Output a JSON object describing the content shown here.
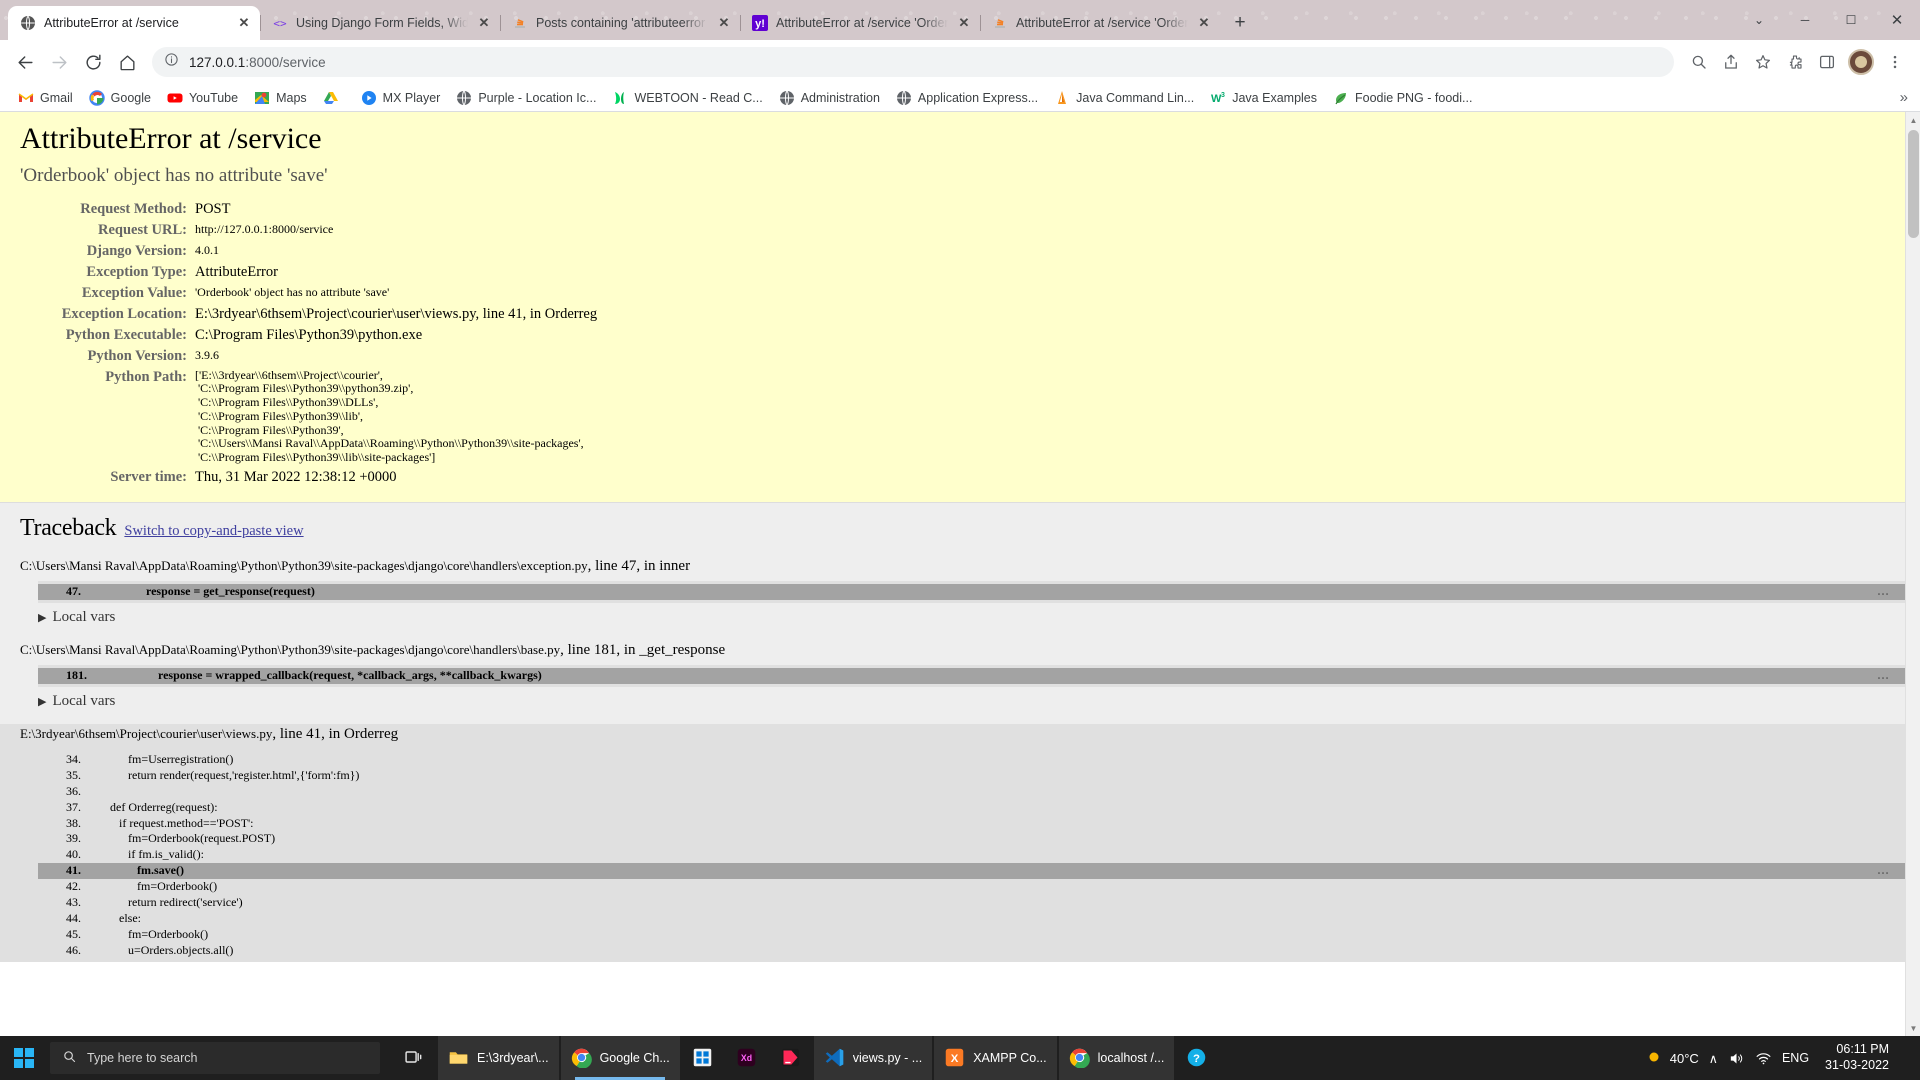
{
  "browser": {
    "tabs": [
      {
        "title": "AttributeError at /service",
        "favicon": "globe-icon",
        "active": true
      },
      {
        "title": "Using Django Form Fields, Widge",
        "favicon": "code-icon",
        "active": false
      },
      {
        "title": "Posts containing 'attributeerror a",
        "favicon": "stackoverflow-icon",
        "active": false
      },
      {
        "title": "AttributeError at /service 'Orderb",
        "favicon": "yahoo-icon",
        "active": false
      },
      {
        "title": "AttributeError at /service 'Orderb",
        "favicon": "stackoverflow-icon",
        "active": false
      }
    ],
    "new_tab_label": "+",
    "window_controls": {
      "minimize": "─",
      "maximize": "☐",
      "close": "✕",
      "restore_down": "⌄"
    },
    "toolbar": {
      "back": "←",
      "forward": "→",
      "reload": "⟳",
      "home": "⌂",
      "url": "127.0.0.1:8000/service",
      "url_host": "127.0.0.1",
      "url_path": ":8000/service",
      "site_info_icon": "info-circle-icon",
      "search_icon": "search-icon",
      "share_icon": "share-icon",
      "bookmark_star": "star-icon",
      "extensions": "puzzle-icon",
      "sidepanel": "sidepanel-icon",
      "menu": "three-dot-menu-icon"
    },
    "bookmarks": [
      {
        "label": "Gmail",
        "icon": "gmail-icon"
      },
      {
        "label": "Google",
        "icon": "google-icon"
      },
      {
        "label": "YouTube",
        "icon": "youtube-icon"
      },
      {
        "label": "Maps",
        "icon": "maps-icon"
      },
      {
        "label": "",
        "icon": "drive-icon"
      },
      {
        "label": "MX Player",
        "icon": "mxplayer-icon"
      },
      {
        "label": "Purple - Location Ic...",
        "icon": "globe-icon"
      },
      {
        "label": "WEBTOON - Read C...",
        "icon": "webtoon-icon"
      },
      {
        "label": "Administration",
        "icon": "globe-icon"
      },
      {
        "label": "Application Express...",
        "icon": "globe-icon"
      },
      {
        "label": "Java Command Lin...",
        "icon": "javatpoint-icon"
      },
      {
        "label": "Java Examples",
        "icon": "w3-icon"
      },
      {
        "label": "Foodie PNG - foodi...",
        "icon": "leaf-icon"
      }
    ],
    "bookmarks_overflow": "»"
  },
  "page": {
    "title": "AttributeError at /service",
    "exception_message": "'Orderbook' object has no attribute 'save'",
    "meta": [
      {
        "label": "Request Method:",
        "value": "POST",
        "small": false
      },
      {
        "label": "Request URL:",
        "value": "http://127.0.0.1:8000/service",
        "small": true
      },
      {
        "label": "Django Version:",
        "value": "4.0.1",
        "small": true
      },
      {
        "label": "Exception Type:",
        "value": "AttributeError",
        "small": false
      },
      {
        "label": "Exception Value:",
        "value": "'Orderbook' object has no attribute 'save'",
        "small": true
      },
      {
        "label": "Exception Location:",
        "value": "E:\\3rdyear\\6thsem\\Project\\courier\\user\\views.py, line 41, in Orderreg",
        "small": false
      },
      {
        "label": "Python Executable:",
        "value": "C:\\Program Files\\Python39\\python.exe",
        "small": false
      },
      {
        "label": "Python Version:",
        "value": "3.9.6",
        "small": true
      }
    ],
    "python_path_label": "Python Path:",
    "python_path": "['E:\\\\3rdyear\\\\6thsem\\\\Project\\\\courier',\n 'C:\\\\Program Files\\\\Python39\\\\python39.zip',\n 'C:\\\\Program Files\\\\Python39\\\\DLLs',\n 'C:\\\\Program Files\\\\Python39\\\\lib',\n 'C:\\\\Program Files\\\\Python39',\n 'C:\\\\Users\\\\Mansi Raval\\\\AppData\\\\Roaming\\\\Python\\\\Python39\\\\site-packages',\n 'C:\\\\Program Files\\\\Python39\\\\lib\\\\site-packages']",
    "server_time_label": "Server time:",
    "server_time": "Thu, 31 Mar 2022 12:38:12 +0000",
    "traceback_heading": "Traceback",
    "traceback_switch_link": "Switch to copy-and-paste view",
    "local_vars_label": "Local vars",
    "frames": [
      {
        "file": "C:\\Users\\Mansi Raval\\AppData\\Roaming\\Python\\Python39\\site-packages\\django\\core\\handlers\\exception.py",
        "line_info": ", line 47, in inner",
        "highlighted": false,
        "lines": [
          {
            "no": "47.",
            "code": "            response = get_response(request)",
            "current": true
          }
        ]
      },
      {
        "file": "C:\\Users\\Mansi Raval\\AppData\\Roaming\\Python\\Python39\\site-packages\\django\\core\\handlers\\base.py",
        "line_info": ", line 181, in _get_response",
        "highlighted": false,
        "lines": [
          {
            "no": "181.",
            "code": "                response = wrapped_callback(request, *callback_args, **callback_kwargs)",
            "current": true
          }
        ]
      },
      {
        "file": "E:\\3rdyear\\6thsem\\Project\\courier\\user\\views.py",
        "line_info": ", line 41, in Orderreg",
        "highlighted": true,
        "lines": [
          {
            "no": "34.",
            "code": "      fm=Userregistration()",
            "current": false
          },
          {
            "no": "35.",
            "code": "      return render(request,'register.html',{'form':fm})",
            "current": false
          },
          {
            "no": "36.",
            "code": "",
            "current": false
          },
          {
            "no": "37.",
            "code": "def Orderreg(request):",
            "current": false
          },
          {
            "no": "38.",
            "code": "   if request.method=='POST':",
            "current": false
          },
          {
            "no": "39.",
            "code": "      fm=Orderbook(request.POST)",
            "current": false
          },
          {
            "no": "40.",
            "code": "      if fm.is_valid():",
            "current": false
          },
          {
            "no": "41.",
            "code": "         fm.save()",
            "current": true
          },
          {
            "no": "42.",
            "code": "         fm=Orderbook()",
            "current": false
          },
          {
            "no": "43.",
            "code": "      return redirect('service')",
            "current": false
          },
          {
            "no": "44.",
            "code": "   else:",
            "current": false
          },
          {
            "no": "45.",
            "code": "      fm=Orderbook()",
            "current": false
          },
          {
            "no": "46.",
            "code": "      u=Orders.objects.all()",
            "current": false
          }
        ]
      }
    ],
    "ellipsis": "…"
  },
  "taskbar": {
    "search_placeholder": "Type here to search",
    "search_icon": "magnifier-icon",
    "start_icon": "windows-logo-icon",
    "taskview_icon": "task-view-icon",
    "apps": [
      {
        "label": "E:\\3rdyear\\...",
        "icon": "folder-icon",
        "open": true,
        "active": false
      },
      {
        "label": "Google Ch...",
        "icon": "chrome-icon",
        "open": true,
        "active": true
      },
      {
        "label": "",
        "icon": "microsoft-store-icon",
        "open": false,
        "active": false
      },
      {
        "label": "",
        "icon": "adobe-xd-icon",
        "open": false,
        "active": false
      },
      {
        "label": "",
        "icon": "jetbrains-icon",
        "open": false,
        "active": false
      },
      {
        "label": "views.py - ...",
        "icon": "vscode-icon",
        "open": true,
        "active": false
      },
      {
        "label": "XAMPP Co...",
        "icon": "xampp-icon",
        "open": true,
        "active": false
      },
      {
        "label": "localhost /...",
        "icon": "chrome-icon",
        "open": true,
        "active": false
      },
      {
        "label": "",
        "icon": "help-icon",
        "open": false,
        "active": false
      }
    ],
    "weather": {
      "temp": "40°C",
      "icon": "sun-icon"
    },
    "tray": {
      "chevron": "∧",
      "network_icon": "wifi-icon",
      "volume_icon": "speaker-icon",
      "language": "ENG",
      "ime_icon": "ime-icon"
    },
    "clock": {
      "time": "06:11 PM",
      "date": "31-03-2022"
    }
  }
}
